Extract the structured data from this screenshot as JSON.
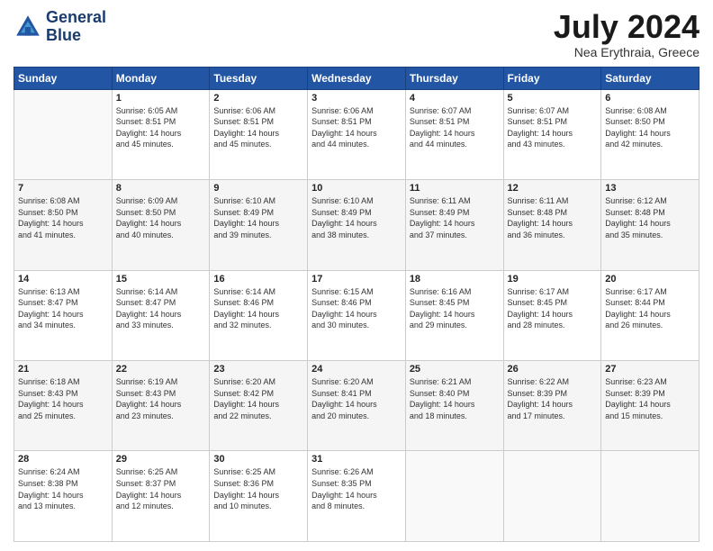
{
  "logo": {
    "line1": "General",
    "line2": "Blue"
  },
  "title": "July 2024",
  "location": "Nea Erythraia, Greece",
  "days_of_week": [
    "Sunday",
    "Monday",
    "Tuesday",
    "Wednesday",
    "Thursday",
    "Friday",
    "Saturday"
  ],
  "weeks": [
    [
      {
        "day": "",
        "info": ""
      },
      {
        "day": "1",
        "info": "Sunrise: 6:05 AM\nSunset: 8:51 PM\nDaylight: 14 hours\nand 45 minutes."
      },
      {
        "day": "2",
        "info": "Sunrise: 6:06 AM\nSunset: 8:51 PM\nDaylight: 14 hours\nand 45 minutes."
      },
      {
        "day": "3",
        "info": "Sunrise: 6:06 AM\nSunset: 8:51 PM\nDaylight: 14 hours\nand 44 minutes."
      },
      {
        "day": "4",
        "info": "Sunrise: 6:07 AM\nSunset: 8:51 PM\nDaylight: 14 hours\nand 44 minutes."
      },
      {
        "day": "5",
        "info": "Sunrise: 6:07 AM\nSunset: 8:51 PM\nDaylight: 14 hours\nand 43 minutes."
      },
      {
        "day": "6",
        "info": "Sunrise: 6:08 AM\nSunset: 8:50 PM\nDaylight: 14 hours\nand 42 minutes."
      }
    ],
    [
      {
        "day": "7",
        "info": "Sunrise: 6:08 AM\nSunset: 8:50 PM\nDaylight: 14 hours\nand 41 minutes."
      },
      {
        "day": "8",
        "info": "Sunrise: 6:09 AM\nSunset: 8:50 PM\nDaylight: 14 hours\nand 40 minutes."
      },
      {
        "day": "9",
        "info": "Sunrise: 6:10 AM\nSunset: 8:49 PM\nDaylight: 14 hours\nand 39 minutes."
      },
      {
        "day": "10",
        "info": "Sunrise: 6:10 AM\nSunset: 8:49 PM\nDaylight: 14 hours\nand 38 minutes."
      },
      {
        "day": "11",
        "info": "Sunrise: 6:11 AM\nSunset: 8:49 PM\nDaylight: 14 hours\nand 37 minutes."
      },
      {
        "day": "12",
        "info": "Sunrise: 6:11 AM\nSunset: 8:48 PM\nDaylight: 14 hours\nand 36 minutes."
      },
      {
        "day": "13",
        "info": "Sunrise: 6:12 AM\nSunset: 8:48 PM\nDaylight: 14 hours\nand 35 minutes."
      }
    ],
    [
      {
        "day": "14",
        "info": "Sunrise: 6:13 AM\nSunset: 8:47 PM\nDaylight: 14 hours\nand 34 minutes."
      },
      {
        "day": "15",
        "info": "Sunrise: 6:14 AM\nSunset: 8:47 PM\nDaylight: 14 hours\nand 33 minutes."
      },
      {
        "day": "16",
        "info": "Sunrise: 6:14 AM\nSunset: 8:46 PM\nDaylight: 14 hours\nand 32 minutes."
      },
      {
        "day": "17",
        "info": "Sunrise: 6:15 AM\nSunset: 8:46 PM\nDaylight: 14 hours\nand 30 minutes."
      },
      {
        "day": "18",
        "info": "Sunrise: 6:16 AM\nSunset: 8:45 PM\nDaylight: 14 hours\nand 29 minutes."
      },
      {
        "day": "19",
        "info": "Sunrise: 6:17 AM\nSunset: 8:45 PM\nDaylight: 14 hours\nand 28 minutes."
      },
      {
        "day": "20",
        "info": "Sunrise: 6:17 AM\nSunset: 8:44 PM\nDaylight: 14 hours\nand 26 minutes."
      }
    ],
    [
      {
        "day": "21",
        "info": "Sunrise: 6:18 AM\nSunset: 8:43 PM\nDaylight: 14 hours\nand 25 minutes."
      },
      {
        "day": "22",
        "info": "Sunrise: 6:19 AM\nSunset: 8:43 PM\nDaylight: 14 hours\nand 23 minutes."
      },
      {
        "day": "23",
        "info": "Sunrise: 6:20 AM\nSunset: 8:42 PM\nDaylight: 14 hours\nand 22 minutes."
      },
      {
        "day": "24",
        "info": "Sunrise: 6:20 AM\nSunset: 8:41 PM\nDaylight: 14 hours\nand 20 minutes."
      },
      {
        "day": "25",
        "info": "Sunrise: 6:21 AM\nSunset: 8:40 PM\nDaylight: 14 hours\nand 18 minutes."
      },
      {
        "day": "26",
        "info": "Sunrise: 6:22 AM\nSunset: 8:39 PM\nDaylight: 14 hours\nand 17 minutes."
      },
      {
        "day": "27",
        "info": "Sunrise: 6:23 AM\nSunset: 8:39 PM\nDaylight: 14 hours\nand 15 minutes."
      }
    ],
    [
      {
        "day": "28",
        "info": "Sunrise: 6:24 AM\nSunset: 8:38 PM\nDaylight: 14 hours\nand 13 minutes."
      },
      {
        "day": "29",
        "info": "Sunrise: 6:25 AM\nSunset: 8:37 PM\nDaylight: 14 hours\nand 12 minutes."
      },
      {
        "day": "30",
        "info": "Sunrise: 6:25 AM\nSunset: 8:36 PM\nDaylight: 14 hours\nand 10 minutes."
      },
      {
        "day": "31",
        "info": "Sunrise: 6:26 AM\nSunset: 8:35 PM\nDaylight: 14 hours\nand 8 minutes."
      },
      {
        "day": "",
        "info": ""
      },
      {
        "day": "",
        "info": ""
      },
      {
        "day": "",
        "info": ""
      }
    ]
  ]
}
